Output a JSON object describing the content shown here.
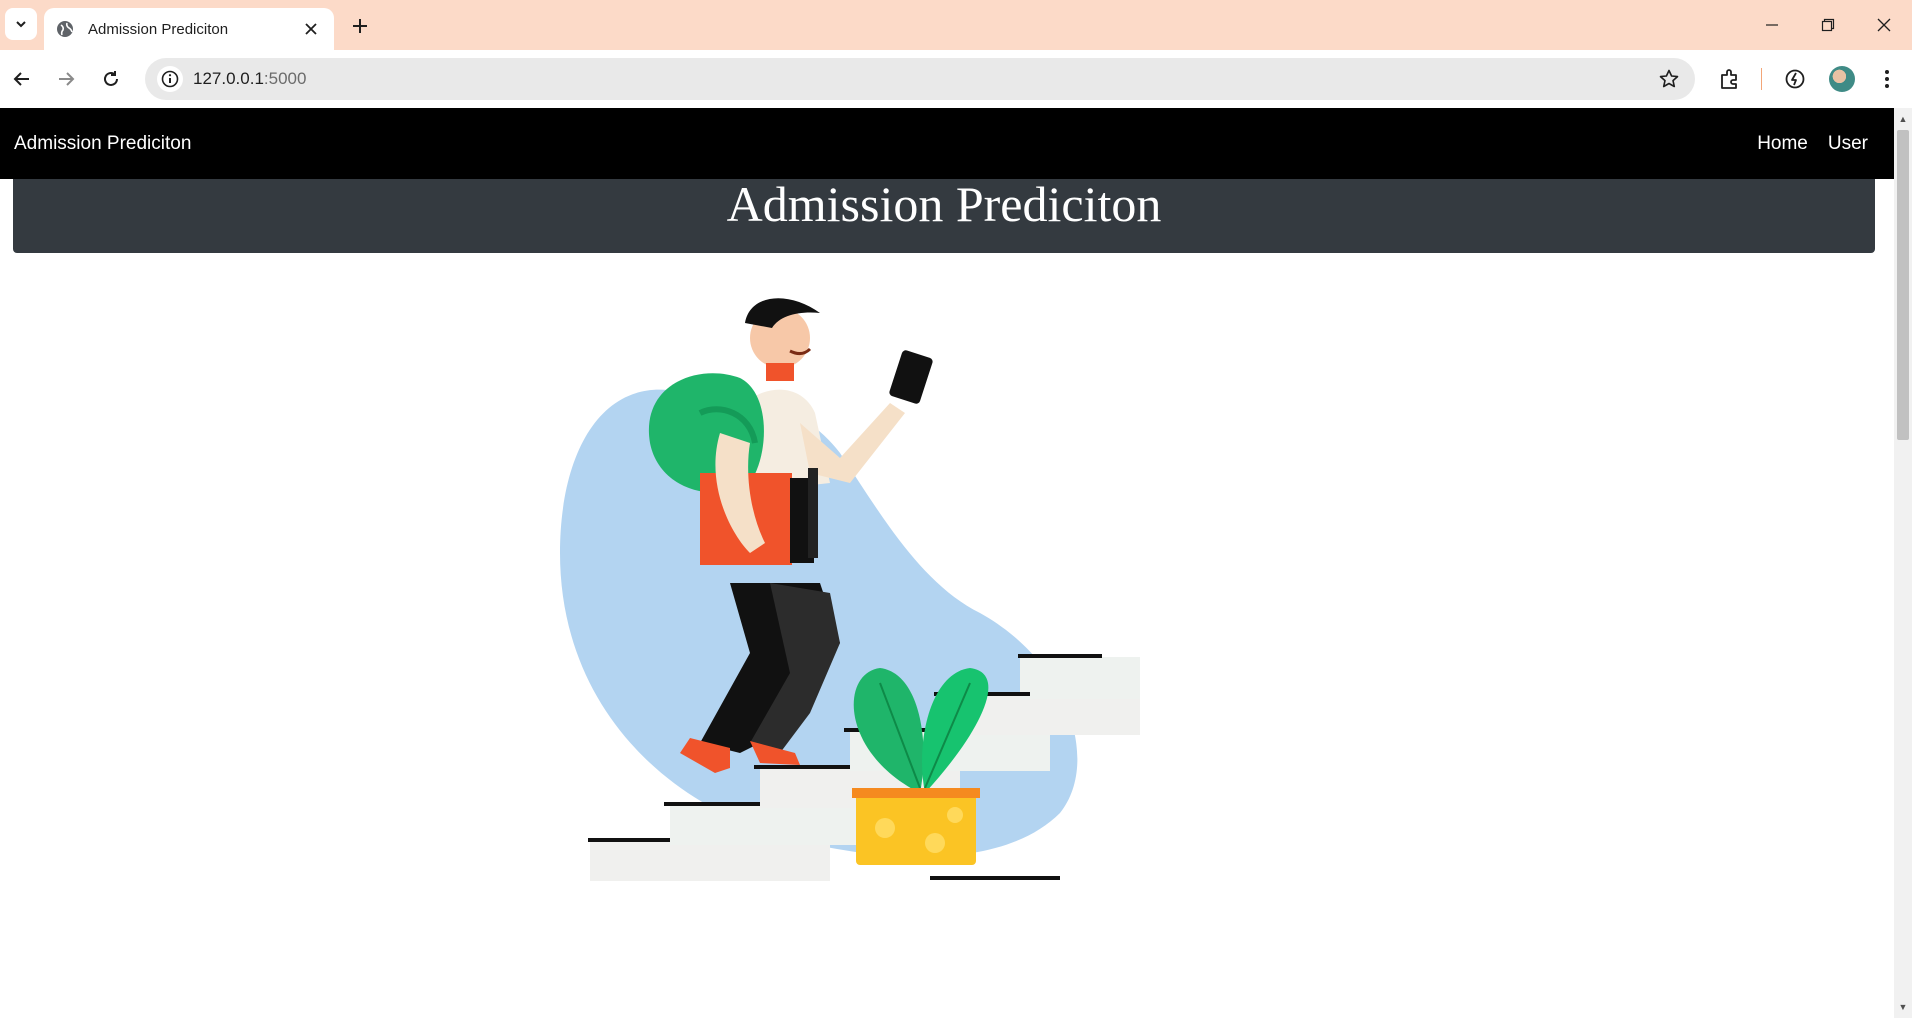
{
  "browser": {
    "tab_title": "Admission Prediciton",
    "url_host": "127.0.0.1",
    "url_port": ":5000"
  },
  "navbar": {
    "brand": "Admission Prediciton",
    "links": [
      {
        "label": "Home"
      },
      {
        "label": "User"
      }
    ]
  },
  "hero": {
    "title": "Admission Prediciton"
  },
  "colors": {
    "navbar_bg": "#000000",
    "jumbotron_bg": "#343a40",
    "tabbar_bg": "#fcdac8"
  },
  "illustration": {
    "icon": "student-climbing-stairs-illustration"
  }
}
